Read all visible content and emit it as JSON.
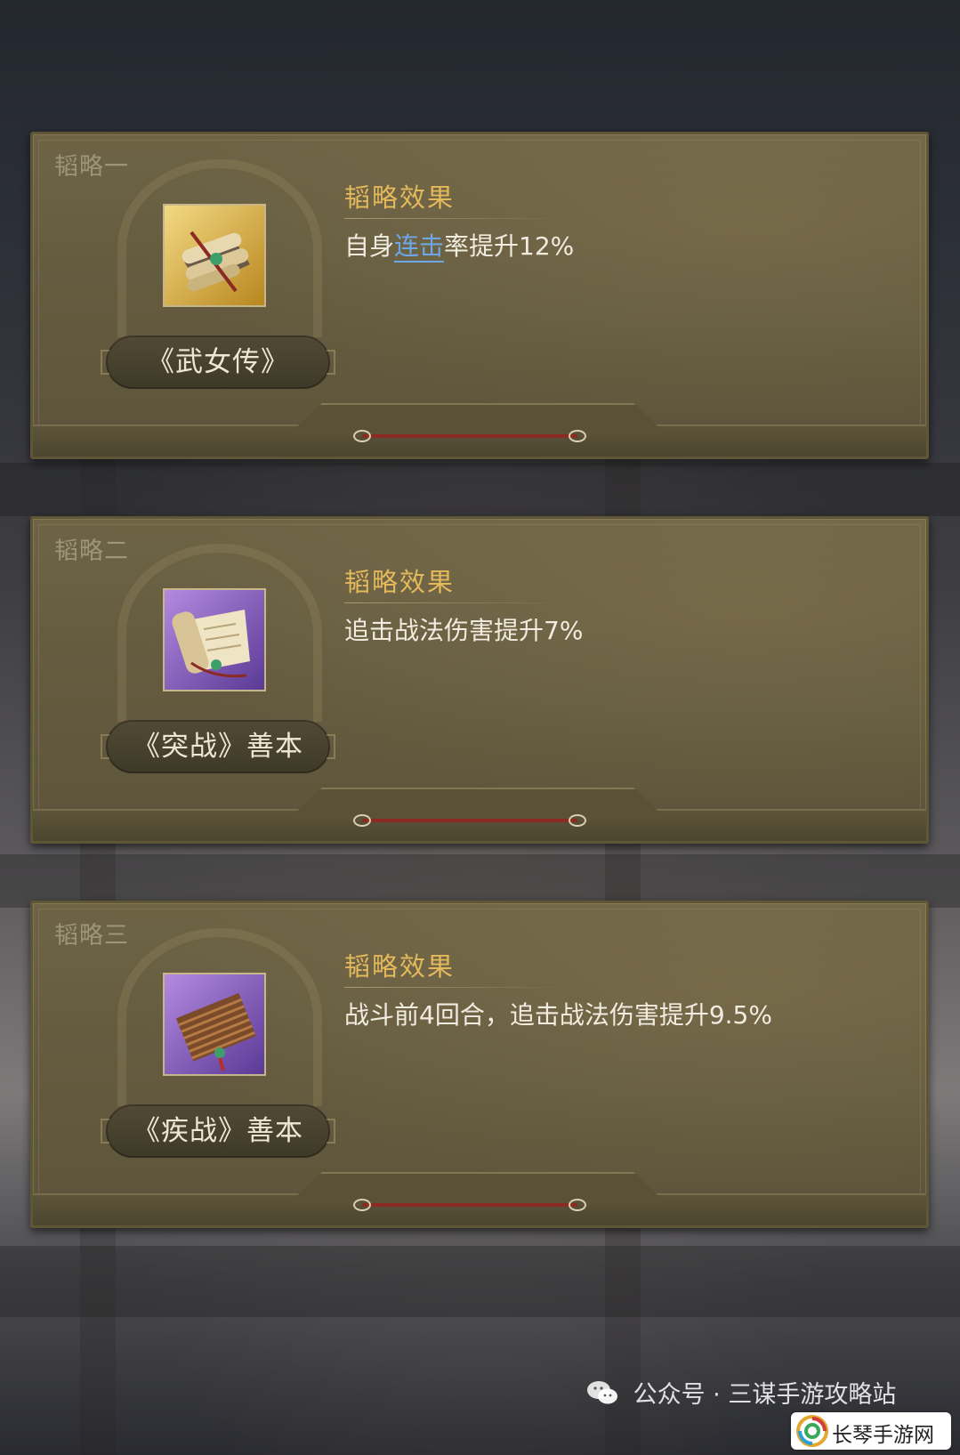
{
  "cards": [
    {
      "slot": "韬略一",
      "item_name": "《武女传》",
      "effect_title": "韬略效果",
      "effect_before": "自身",
      "effect_keyword": "连击",
      "effect_after": "率提升12%",
      "icon": "scroll-bundle-icon",
      "rarity_color": "#c9a23a"
    },
    {
      "slot": "韬略二",
      "item_name": "《突战》善本",
      "effect_title": "韬略效果",
      "effect_text": "追击战法伤害提升7%",
      "icon": "open-scroll-icon",
      "rarity_color": "#7a4fb0"
    },
    {
      "slot": "韬略三",
      "item_name": "《疾战》善本",
      "effect_title": "韬略效果",
      "effect_text": "战斗前4回合，追击战法伤害提升9.5%",
      "icon": "bamboo-slips-icon",
      "rarity_color": "#7a4fb0"
    }
  ],
  "keyword_color": "#6ea7e6",
  "watermark": {
    "public_account": "公众号 · 三谋手游攻略站",
    "site": "长琴手游网"
  }
}
